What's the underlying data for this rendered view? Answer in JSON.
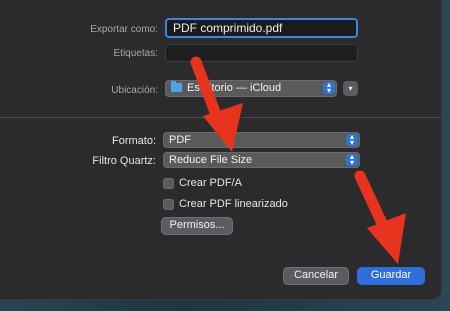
{
  "export_as": {
    "label": "Exportar como:",
    "value": "PDF comprimido.pdf"
  },
  "tags": {
    "label": "Etiquetas:",
    "value": ""
  },
  "location": {
    "label": "Ubicación:",
    "value": "Escritorio — iCloud",
    "icon": "folder-icon"
  },
  "format": {
    "label": "Formato:",
    "value": "PDF"
  },
  "quartz_filter": {
    "label": "Filtro Quartz:",
    "value": "Reduce File Size"
  },
  "options": {
    "pdfa": {
      "label": "Crear PDF/A",
      "checked": false
    },
    "linearized": {
      "label": "Crear PDF linearizado",
      "checked": false
    }
  },
  "permissions_button": "Permisos...",
  "cancel_button": "Cancelar",
  "save_button": "Guardar",
  "colors": {
    "accent": "#2f6fdc",
    "annotation_arrow": "#e8341f"
  }
}
